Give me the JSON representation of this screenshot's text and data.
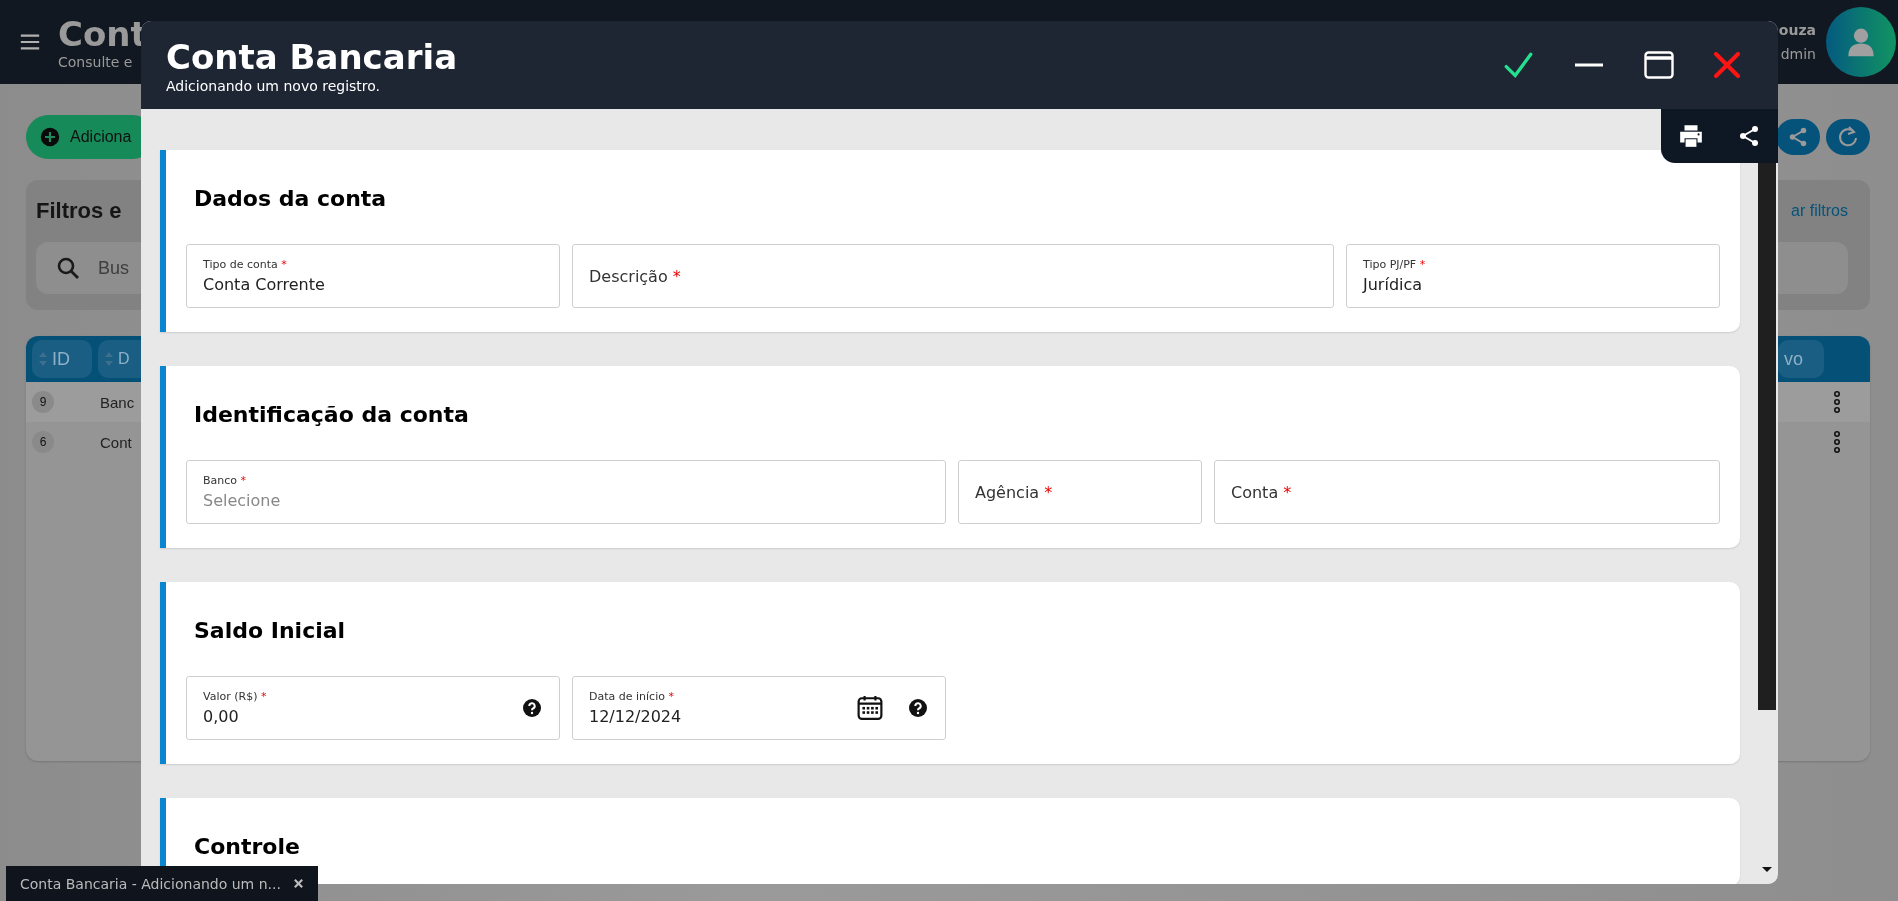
{
  "background_page": {
    "header": {
      "title": "Cont",
      "subtitle": "Consulte e",
      "user_name": "ouza",
      "user_role": "dmin"
    },
    "add_button": {
      "label": "Adiciona"
    },
    "filters": {
      "title": "Filtros e",
      "clear_link": "ar filtros",
      "search": {
        "placeholder": "Bus"
      }
    },
    "table": {
      "columns": [
        {
          "label": "ID"
        },
        {
          "label": "D"
        },
        {
          "label": "vo"
        }
      ],
      "rows": [
        {
          "id": "9",
          "column_2": "Banc"
        },
        {
          "id": "6",
          "column_2": "Cont"
        }
      ]
    }
  },
  "modal": {
    "title": "Conta Bancaria",
    "subtitle": "Adicionando um novo registro.",
    "sections": [
      {
        "title": "Dados da conta",
        "fields": [
          {
            "label": "Tipo de conta",
            "required_mark": "*",
            "value": "Conta Corrente"
          },
          {
            "label": "Descrição",
            "required_mark": "*"
          },
          {
            "label": "Tipo PJ/PF",
            "required_mark": "*",
            "value": "Jurídica"
          }
        ]
      },
      {
        "title": "Identificação da conta",
        "fields": [
          {
            "label": "Banco",
            "required_mark": "*",
            "placeholder": "Selecione"
          },
          {
            "label": "Agência",
            "required_mark": "*"
          },
          {
            "label": "Conta",
            "required_mark": "*"
          }
        ]
      },
      {
        "title": "Saldo Inicial",
        "fields": [
          {
            "label": "Valor (R$)",
            "required_mark": "*",
            "value": "0,00",
            "help_icon": true
          },
          {
            "label": "Data de início",
            "required_mark": "*",
            "value": "12/12/2024",
            "calendar_icon": true,
            "help_icon": true
          }
        ]
      },
      {
        "title": "Controle"
      }
    ]
  },
  "taskbar": [
    {
      "label": "Conta Bancaria - Adicionando um n..."
    }
  ]
}
